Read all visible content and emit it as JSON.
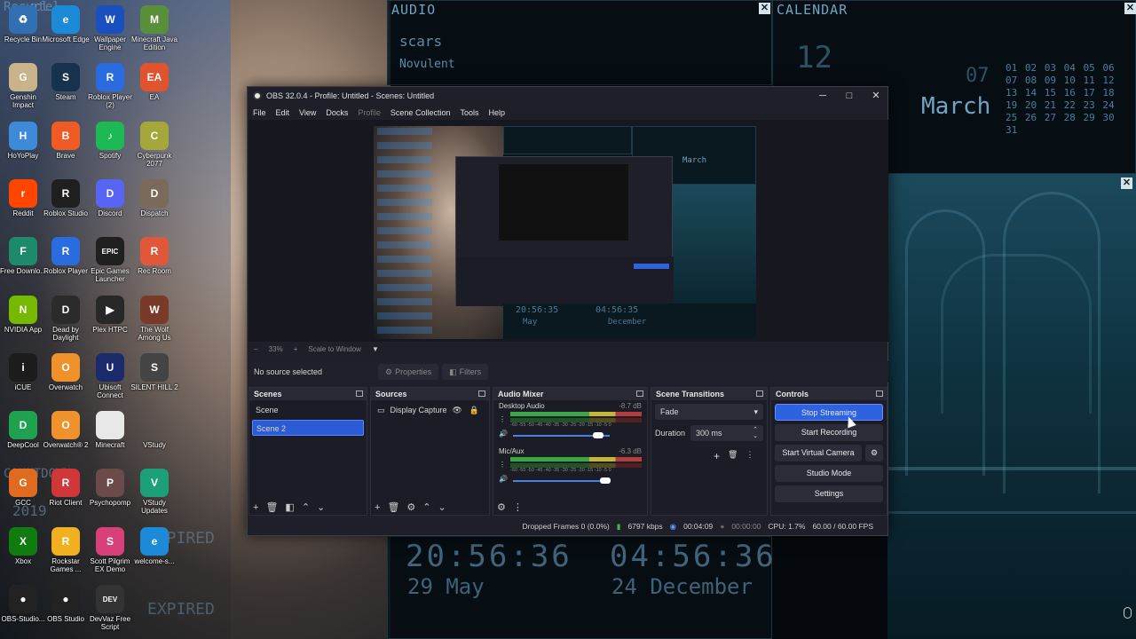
{
  "desktop": {
    "icons": [
      {
        "label": "Recycle Bin",
        "color": "#2f6fb2",
        "glyph": "♻"
      },
      {
        "label": "Microsoft Edge",
        "color": "#1c8ad6",
        "glyph": "e"
      },
      {
        "label": "Wallpaper Engine",
        "color": "#1a4fbf",
        "glyph": "W"
      },
      {
        "label": "Minecraft Java Edition",
        "color": "#5a8f3a",
        "glyph": "M"
      },
      {
        "label": "Genshin Impact",
        "color": "#c9b38a",
        "glyph": "G"
      },
      {
        "label": "Steam",
        "color": "#16324c",
        "glyph": "S"
      },
      {
        "label": "Roblox Player (2)",
        "color": "#2a6be0",
        "glyph": "R"
      },
      {
        "label": "EA",
        "color": "#e0532c",
        "glyph": "EA"
      },
      {
        "label": "HoYoPlay",
        "color": "#3d8ad8",
        "glyph": "H"
      },
      {
        "label": "Brave",
        "color": "#f05a24",
        "glyph": "B"
      },
      {
        "label": "Spotify",
        "color": "#1db954",
        "glyph": "♪"
      },
      {
        "label": "Cyberpunk 2077",
        "color": "#a4a83a",
        "glyph": "C"
      },
      {
        "label": "Reddit",
        "color": "#ff4500",
        "glyph": "r"
      },
      {
        "label": "Roblox Studio",
        "color": "#1f1f1f",
        "glyph": "R"
      },
      {
        "label": "Discord",
        "color": "#5865f2",
        "glyph": "D"
      },
      {
        "label": "Dispatch",
        "color": "#7a6a5a",
        "glyph": "D"
      },
      {
        "label": "Free Downlo...",
        "color": "#1c8a6b",
        "glyph": "F"
      },
      {
        "label": "Roblox Player",
        "color": "#2a6be0",
        "glyph": "R"
      },
      {
        "label": "Epic Games Launcher",
        "color": "#202020",
        "glyph": "EPIC"
      },
      {
        "label": "Rec Room",
        "color": "#e0573a",
        "glyph": "R"
      },
      {
        "label": "NVIDIA App",
        "color": "#76b900",
        "glyph": "N"
      },
      {
        "label": "Dead by Daylight",
        "color": "#2b2b2b",
        "glyph": "D"
      },
      {
        "label": "Plex HTPC",
        "color": "#282828",
        "glyph": "▶"
      },
      {
        "label": "The Wolf Among Us",
        "color": "#7a3a2a",
        "glyph": "W"
      },
      {
        "label": "iCUE",
        "color": "#1c1c1c",
        "glyph": "i"
      },
      {
        "label": "Overwatch",
        "color": "#f0922b",
        "glyph": "O"
      },
      {
        "label": "Ubisoft Connect",
        "color": "#1a2a6b",
        "glyph": "U"
      },
      {
        "label": "SILENT HILL 2",
        "color": "#444",
        "glyph": "S"
      },
      {
        "label": "DeepCool",
        "color": "#1fa24f",
        "glyph": "D"
      },
      {
        "label": "Overwatch® 2",
        "color": "#f0922b",
        "glyph": "O"
      },
      {
        "label": "Minecraft",
        "color": "#e8e8e8",
        "glyph": ""
      },
      {
        "label": "VStudy",
        "color": "transparent",
        "glyph": ""
      },
      {
        "label": "GCC",
        "color": "#e06a20",
        "glyph": "G"
      },
      {
        "label": "Riot Client",
        "color": "#d13639",
        "glyph": "R"
      },
      {
        "label": "Psychopomp",
        "color": "#6b4a4a",
        "glyph": "P"
      },
      {
        "label": "VStudy Updates",
        "color": "#1ba07a",
        "glyph": "V"
      },
      {
        "label": "Xbox",
        "color": "#107c10",
        "glyph": "X"
      },
      {
        "label": "Rockstar Games ...",
        "color": "#f0b020",
        "glyph": "R"
      },
      {
        "label": "Scott Pilgrim EX Demo",
        "color": "#d8407a",
        "glyph": "S"
      },
      {
        "label": "welcome-s...",
        "color": "#1c8ad6",
        "glyph": "e"
      },
      {
        "label": "OBS-Studio...",
        "color": "#222",
        "glyph": "●"
      },
      {
        "label": "OBS Studio",
        "color": "#222",
        "glyph": "●"
      },
      {
        "label": "DevVaz Free Script",
        "color": "#333",
        "glyph": "DEV"
      }
    ],
    "faded_texts": [
      "Recycl",
      "ntel",
      "COUNTDOWN",
      "2019",
      "U...",
      "EXPIRED",
      "EXPIRED"
    ]
  },
  "widgets": {
    "audio": {
      "title": "AUDIO",
      "track": "scars",
      "artist": "Novulent"
    },
    "calendar": {
      "title": "CALENDAR",
      "day": "12",
      "month_num": "07",
      "month": "March",
      "days": "01 02 03 04 05 06 07 08 09 10 11 12 13 14 15 16 17 18 19 20 21 22 23 24 25 26 27 28 29 30 31"
    },
    "clocks": [
      {
        "time": "20:56:36",
        "date": "29 May"
      },
      {
        "time": "04:56:36",
        "date": "24 December"
      }
    ]
  },
  "obs": {
    "title": "OBS 32.0.4 - Profile: Untitled - Scenes: Untitled",
    "menu": [
      {
        "label": "File",
        "enabled": true
      },
      {
        "label": "Edit",
        "enabled": true
      },
      {
        "label": "View",
        "enabled": true
      },
      {
        "label": "Docks",
        "enabled": true
      },
      {
        "label": "Profile",
        "enabled": false
      },
      {
        "label": "Scene Collection",
        "enabled": true
      },
      {
        "label": "Tools",
        "enabled": true
      },
      {
        "label": "Help",
        "enabled": true
      }
    ],
    "zoom": {
      "minus": "−",
      "value": "33%",
      "plus": "+",
      "mode": "Scale to Window"
    },
    "source_toolbar": {
      "no_source": "No source selected",
      "properties": "Properties",
      "filters": "Filters"
    },
    "scenes": {
      "title": "Scenes",
      "items": [
        "Scene",
        "Scene 2"
      ],
      "selected": 1
    },
    "sources": {
      "title": "Sources",
      "items": [
        "Display Capture"
      ]
    },
    "mixer": {
      "title": "Audio Mixer",
      "channels": [
        {
          "name": "Desktop Audio",
          "db": "-8.7 dB",
          "scale": "-60 -55 -50 -45 -40 -35 -30 -25 -20 -15 -10 -5 0",
          "level": 0.72
        },
        {
          "name": "Mic/Aux",
          "db": "-6.3 dB",
          "scale": "-60 -55 -50 -45 -40 -35 -30 -25 -20 -15 -10 -5 0",
          "level": 0.76
        }
      ]
    },
    "transitions": {
      "title": "Scene Transitions",
      "type": "Fade",
      "duration_label": "Duration",
      "duration": "300 ms"
    },
    "controls": {
      "title": "Controls",
      "stop_streaming": "Stop Streaming",
      "start_recording": "Start Recording",
      "virtual_camera": "Start Virtual Camera",
      "studio_mode": "Studio Mode",
      "settings": "Settings"
    },
    "status": {
      "dropped": "Dropped Frames 0 (0.0%)",
      "kbps": "6797 kbps",
      "stream_time": "00:04:09",
      "rec_time": "00:00:00",
      "cpu": "CPU: 1.7%",
      "fps": "60.00 / 60.00 FPS"
    },
    "preview": {
      "calendar_month": "March",
      "clock1": "20:56:35",
      "clock2": "04:56:35",
      "date1": "May",
      "date2": "December"
    }
  },
  "colors": {
    "accent": "#2d62e0",
    "obs_bg": "#1e1f29",
    "widget_text": "#6fa4c3"
  }
}
